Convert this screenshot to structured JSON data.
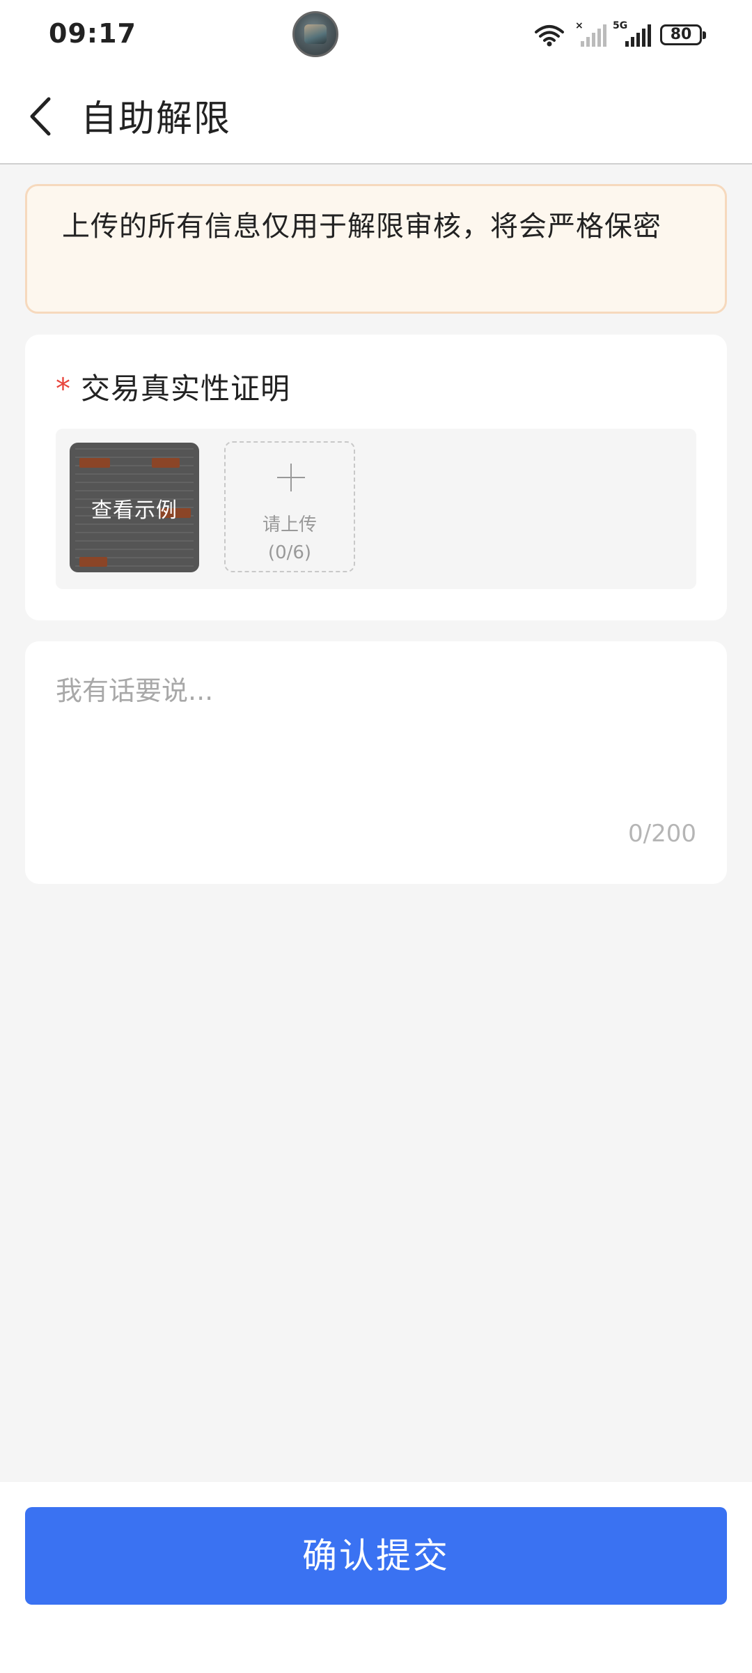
{
  "status_bar": {
    "time": "09:17",
    "battery": "80",
    "network_label": "5G"
  },
  "nav": {
    "title": "自助解限"
  },
  "notice": {
    "text": "上传的所有信息仅用于解限审核，将会严格保密"
  },
  "upload_section": {
    "required_mark": "*",
    "title": "交易真实性证明",
    "example_label": "查看示例",
    "upload_label": "请上传",
    "upload_count": "(0/6)"
  },
  "message": {
    "placeholder": "我有话要说...",
    "char_count": "0/200"
  },
  "submit": {
    "label": "确认提交"
  },
  "colors": {
    "primary": "#3a72f2",
    "notice_bg": "#fdf7ee",
    "notice_border": "#f6d9bd",
    "required": "#e8453c",
    "page_bg": "#f5f5f5"
  }
}
